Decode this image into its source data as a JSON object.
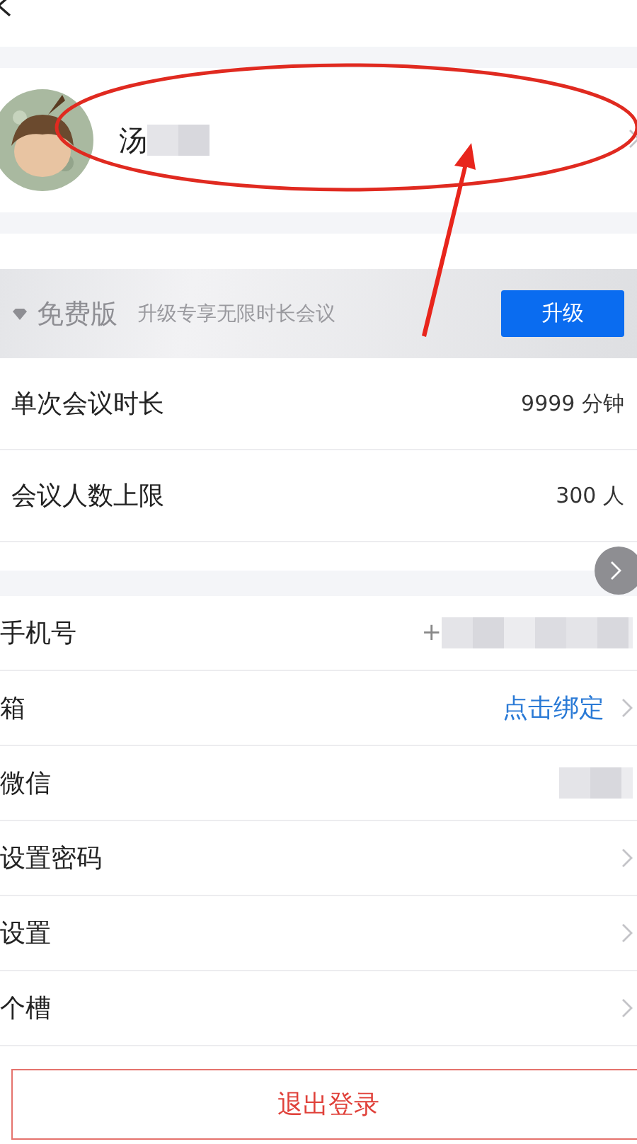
{
  "profile": {
    "name": "汤"
  },
  "plan": {
    "edition": "免费版",
    "promo": "升级专享无限时长会议",
    "button": "升级"
  },
  "limits": [
    {
      "label": "单次会议时长",
      "value": "9999 分钟"
    },
    {
      "label": "会议人数上限",
      "value": "300 人"
    }
  ],
  "account": [
    {
      "label": "手机号",
      "kind": "masked",
      "value": "+",
      "arrow": false
    },
    {
      "label": "箱",
      "kind": "link",
      "value": "点击绑定",
      "arrow": true
    },
    {
      "label": "微信",
      "kind": "masked",
      "arrow": false
    },
    {
      "label": "设置密码",
      "kind": "plain",
      "arrow": true
    },
    {
      "label": "设置",
      "kind": "plain",
      "arrow": true
    },
    {
      "label": "个槽",
      "kind": "plain",
      "arrow": true
    }
  ],
  "logout": "退出登录"
}
